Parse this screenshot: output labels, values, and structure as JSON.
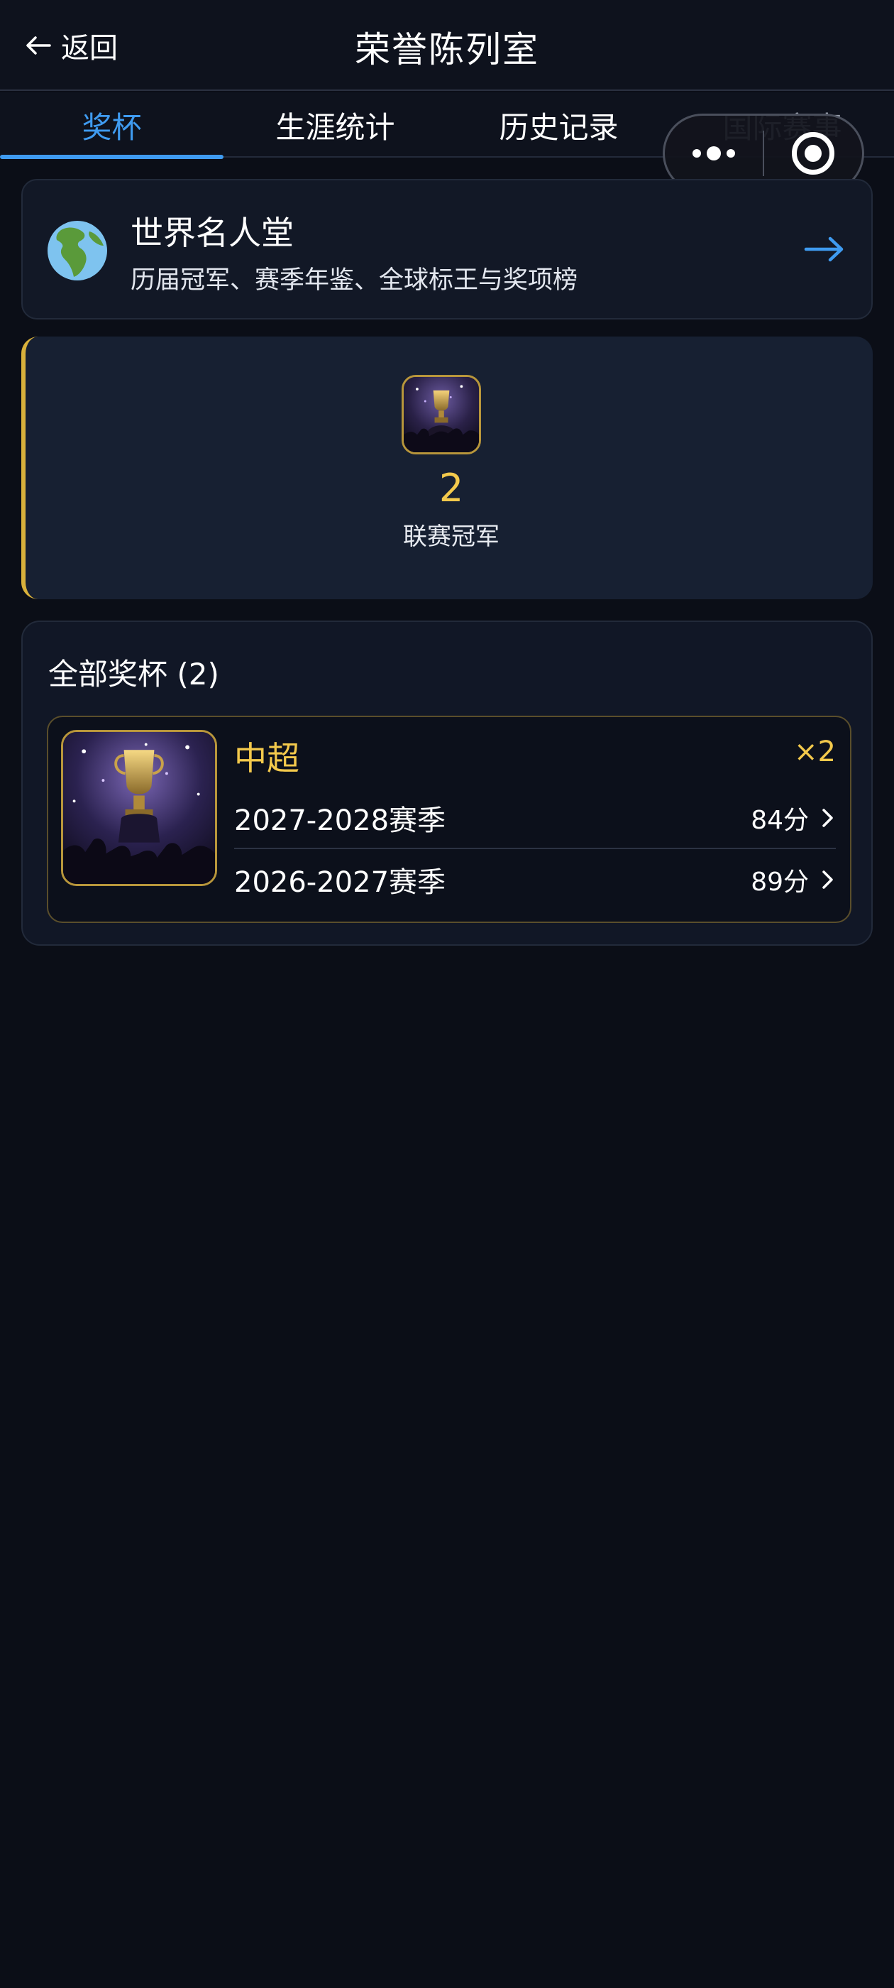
{
  "header": {
    "back_label": "返回",
    "title": "荣誉陈列室"
  },
  "tabs": [
    {
      "label": "奖杯",
      "active": true
    },
    {
      "label": "生涯统计",
      "active": false
    },
    {
      "label": "历史记录",
      "active": false
    },
    {
      "label": "国际赛事",
      "active": false
    }
  ],
  "hall_of_fame": {
    "title": "世界名人堂",
    "subtitle": "历届冠军、赛季年鉴、全球标王与奖项榜"
  },
  "summary": {
    "count": "2",
    "label": "联赛冠军"
  },
  "all_trophies": {
    "title": "全部奖杯 (2)",
    "items": [
      {
        "league": "中超",
        "times": "×2",
        "seasons": [
          {
            "season": "2027-2028赛季",
            "points": "84分"
          },
          {
            "season": "2026-2027赛季",
            "points": "89分"
          }
        ]
      }
    ]
  },
  "colors": {
    "accent_blue": "#3f9bf0",
    "gold": "#f3c94c",
    "background": "#0b0e17"
  },
  "icons": {
    "back": "arrow-left-icon",
    "hall_of_fame": "globe-icon",
    "go": "arrow-right-icon",
    "row": "chevron-right-icon",
    "menu": "more-dots-icon",
    "close": "record-circle-icon"
  }
}
